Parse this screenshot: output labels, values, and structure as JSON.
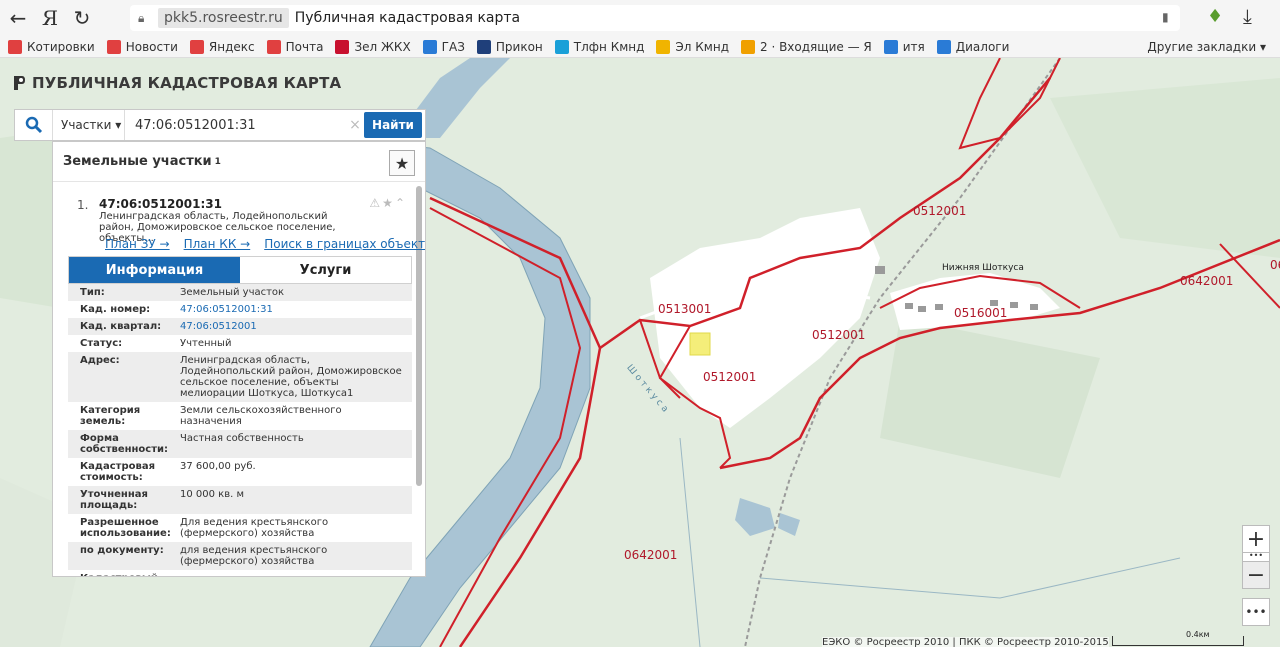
{
  "browser": {
    "domain": "pkk5.rosreestr.ru",
    "page_title": "Публичная кадастровая карта",
    "bookmarks": [
      {
        "label": "Котировки",
        "color": "#e04040"
      },
      {
        "label": "Новости",
        "color": "#e04040"
      },
      {
        "label": "Яндекс",
        "color": "#e04040"
      },
      {
        "label": "Почта",
        "color": "#e04040"
      },
      {
        "label": "Зел ЖКХ",
        "color": "#c8102e"
      },
      {
        "label": "ГАЗ",
        "color": "#2a7bd6"
      },
      {
        "label": "Прикон",
        "color": "#1f3f7a"
      },
      {
        "label": "Тлфн Кмнд",
        "color": "#1aa0d8"
      },
      {
        "label": "Эл Кмнд",
        "color": "#f0b400"
      },
      {
        "label": "2 · Входящие — Я",
        "color": "#f0a000"
      },
      {
        "label": "итя",
        "color": "#2a7bd6"
      },
      {
        "label": "Диалоги",
        "color": "#2a7bd6"
      }
    ],
    "other_bookmarks": "Другие закладки ▾"
  },
  "site": {
    "title": "ПУБЛИЧНАЯ КАДАСТРОВАЯ КАРТА"
  },
  "search": {
    "type": "Участки ▾",
    "value": "47:06:0512001:31",
    "button": "Найти"
  },
  "results": {
    "heading": "Земельные участки",
    "count": "1",
    "item": {
      "index": "1.",
      "title": "47:06:0512001:31",
      "address": "Ленинградская область, Лодейнопольский район, Доможировское сельское поселение, объекты...",
      "tools": "⚠★⌃",
      "links": [
        "План ЗУ →",
        "План КК →",
        "Поиск в границах объекта →"
      ]
    },
    "tabs": [
      "Информация",
      "Услуги"
    ],
    "info": [
      {
        "k": "Тип:",
        "v": "Земельный участок"
      },
      {
        "k": "Кад. номер:",
        "v": "47:06:0512001:31"
      },
      {
        "k": "Кад. квартал:",
        "v": "47:06:0512001"
      },
      {
        "k": "Статус:",
        "v": "Учтенный"
      },
      {
        "k": "Адрес:",
        "v": "Ленинградская область, Лодейнопольский район, Доможировское сельское поселение, объекты мелиорации Шоткуса, Шоткуса1"
      },
      {
        "k": "Категория земель:",
        "v": "Земли сельскохозяйственного назначения"
      },
      {
        "k": "Форма собственности:",
        "v": "Частная собственность"
      },
      {
        "k": "Кадастровая стоимость:",
        "v": "37 600,00 руб."
      },
      {
        "k": "Уточненная площадь:",
        "v": "10 000 кв. м"
      },
      {
        "k": "Разрешенное использование:",
        "v": "Для ведения крестьянского (фермерского) хозяйства"
      },
      {
        "k": "по документу:",
        "v": "для ведения крестьянского (фермерского) хозяйства"
      },
      {
        "k": "Кадастровый",
        "v": "-"
      }
    ]
  },
  "map": {
    "labels": [
      "0513001",
      "0512001",
      "0512001",
      "0512001",
      "0516001",
      "0642001",
      "0642001"
    ],
    "places": [
      "Нижняя Шоткуса",
      "Ш о т к у с а",
      "06"
    ],
    "copyright": "ЕЭКО © Росреестр 2010 | ПКК © Росреестр 2010-2015",
    "scale": "0.4км"
  },
  "colors": {
    "accent": "#1a6ab3",
    "boundary": "#d0202a",
    "river": "#a9c4d4"
  }
}
